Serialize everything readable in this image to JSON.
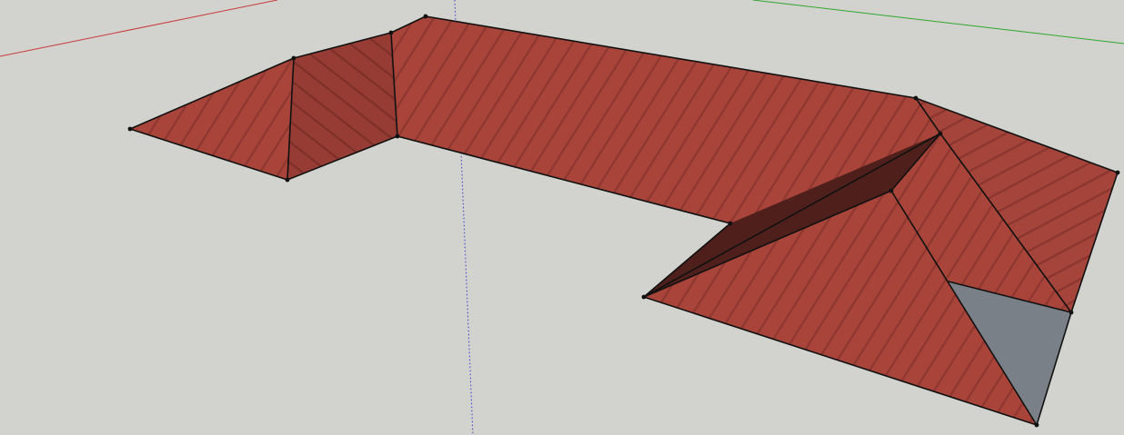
{
  "viewport": {
    "background": "#d2d2ce"
  },
  "axes": {
    "red": "#c83a3a",
    "green": "#2fa82f",
    "blue": "#3a3ac8"
  },
  "materials": {
    "roof_tile_base": "#a8443a",
    "roof_tile_stripe": "#8e3630",
    "roof_shadow": "#8f3a32",
    "roof_dark_valley": "#4e1f1b",
    "inner_face_gray": "#7a8088",
    "edge": "#111111"
  }
}
